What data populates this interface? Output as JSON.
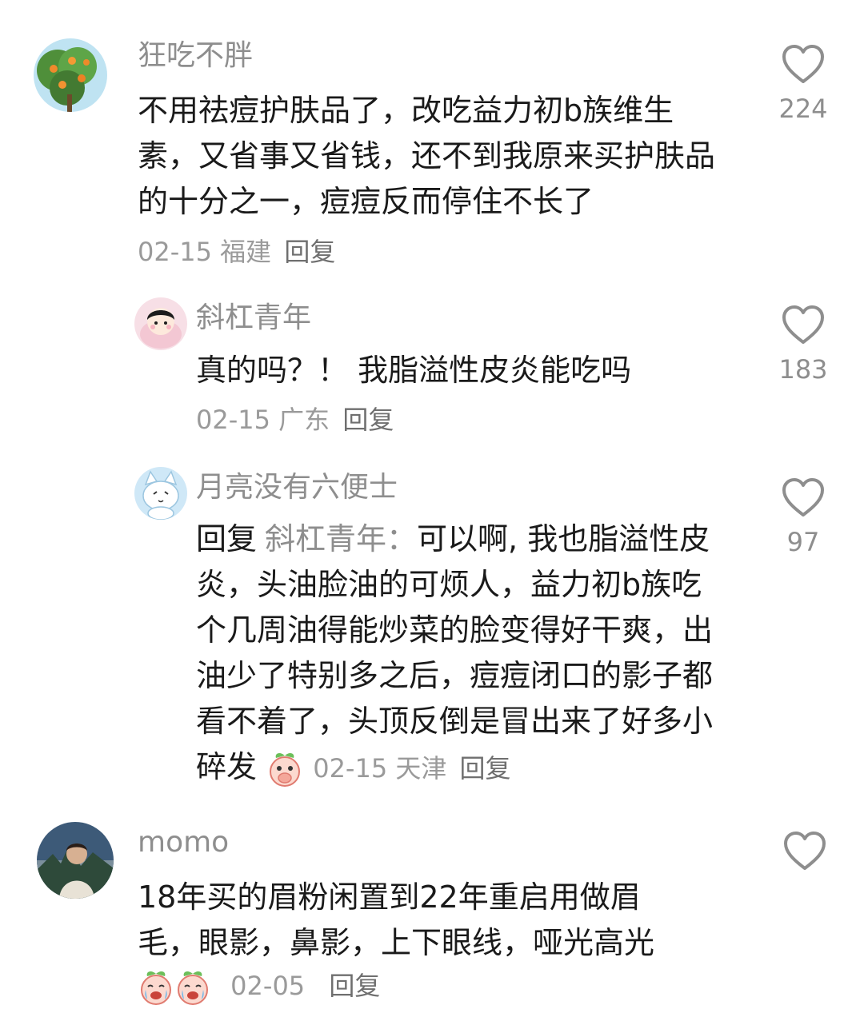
{
  "comments": [
    {
      "author": "狂吃不胖",
      "avatar_icon": "orange-tree-avatar",
      "text": "不用祛痘护肤品了，改吃益力初b族维生素，又省事又省钱，还不到我原来买护肤品的十分之一，痘痘反而停住不长了",
      "date": "02-15",
      "location": "福建",
      "reply_label": "回复",
      "likes": "224"
    },
    {
      "author": "斜杠青年",
      "avatar_icon": "cartoon-boy-avatar",
      "text": "真的吗？！ 我脂溢性皮炎能吃吗",
      "date": "02-15",
      "location": "广东",
      "reply_label": "回复",
      "likes": "183"
    },
    {
      "author": "月亮没有六便士",
      "avatar_icon": "white-cat-avatar",
      "reply_prefix": "回复",
      "reply_target": "斜杠青年：",
      "text": "可以啊, 我也脂溢性皮炎，头油脸油的可烦人，益力初b族吃个几周油得能炒菜的脸变得好干爽，出油少了特别多之后，痘痘闭口的影子都看不着了，头顶反倒是冒出来了好多小碎发",
      "emoji_icon": "covering-mouth-peach-emoji",
      "date": "02-15",
      "location": "天津",
      "reply_label": "回复",
      "likes": "97"
    },
    {
      "author": "momo",
      "avatar_icon": "person-photo-avatar",
      "text": "18年买的眉粉闲置到22年重启用做眉毛，眼影，鼻影，上下眼线，哑光高光",
      "emoji_icons": [
        "crying-peach-emoji",
        "crying-peach-emoji"
      ],
      "date": "02-05",
      "reply_label": "回复",
      "likes": ""
    }
  ],
  "colors": {
    "text": "#1a1a1a",
    "muted": "#8e8e8e",
    "background": "#ffffff"
  }
}
